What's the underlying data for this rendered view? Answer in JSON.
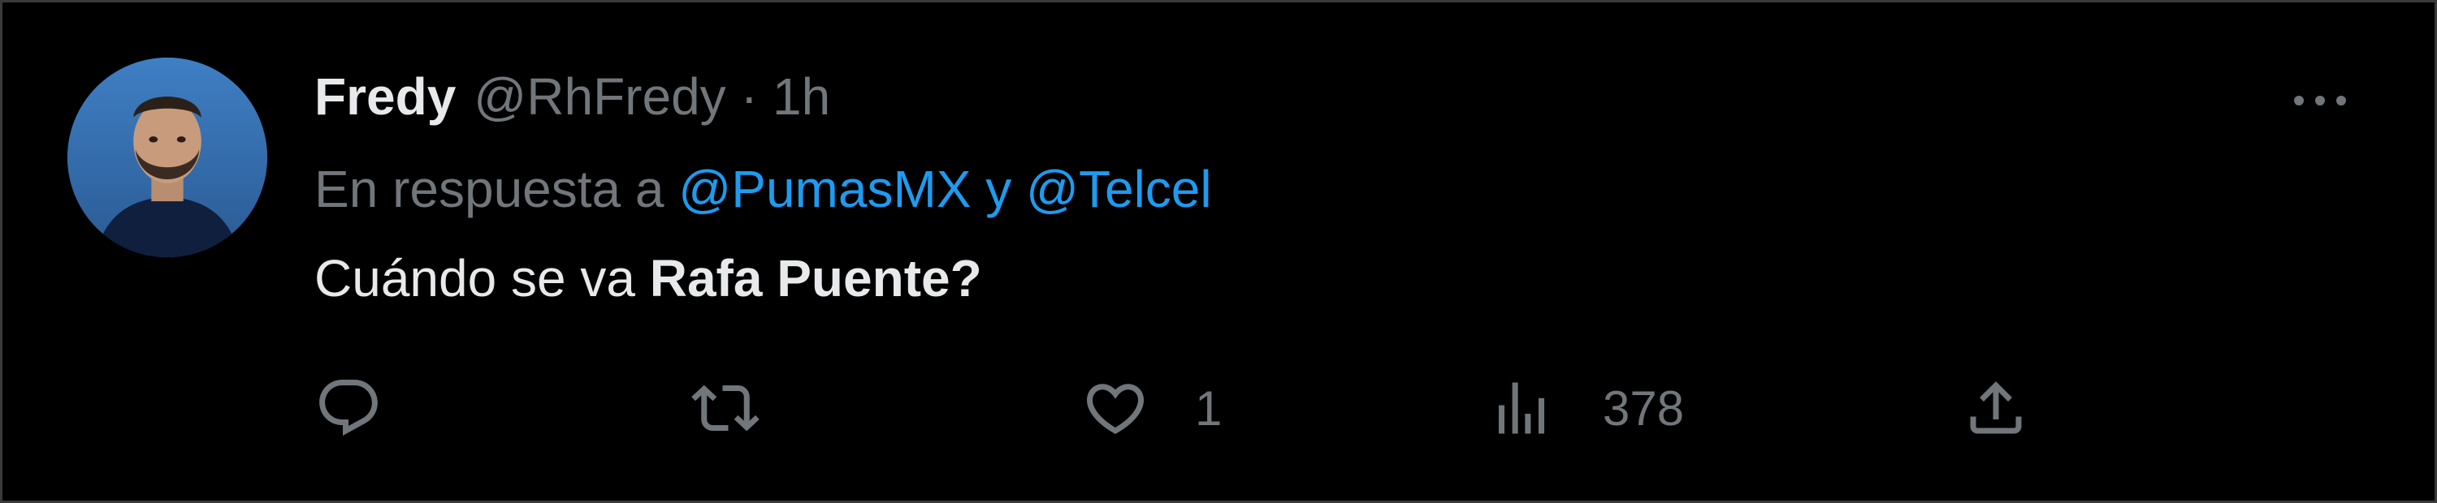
{
  "tweet": {
    "display_name": "Fredy",
    "handle": "@RhFredy",
    "separator": "·",
    "time": "1h",
    "reply_prefix": "En respuesta a",
    "reply_mention_1": "@PumasMX",
    "reply_joiner": "y",
    "reply_mention_2": "@Telcel",
    "text_part_1": "Cuándo se va",
    "text_part_2": "Rafa Puente?"
  },
  "actions": {
    "reply_icon": "reply-icon",
    "retweet_icon": "retweet-icon",
    "like_icon": "heart-icon",
    "like_count": "1",
    "views_icon": "views-icon",
    "views_count": "378",
    "share_icon": "share-icon"
  },
  "colors": {
    "background": "#000000",
    "text_primary": "#e7e9ea",
    "text_secondary": "#71767b",
    "link": "#1d9bf0"
  }
}
